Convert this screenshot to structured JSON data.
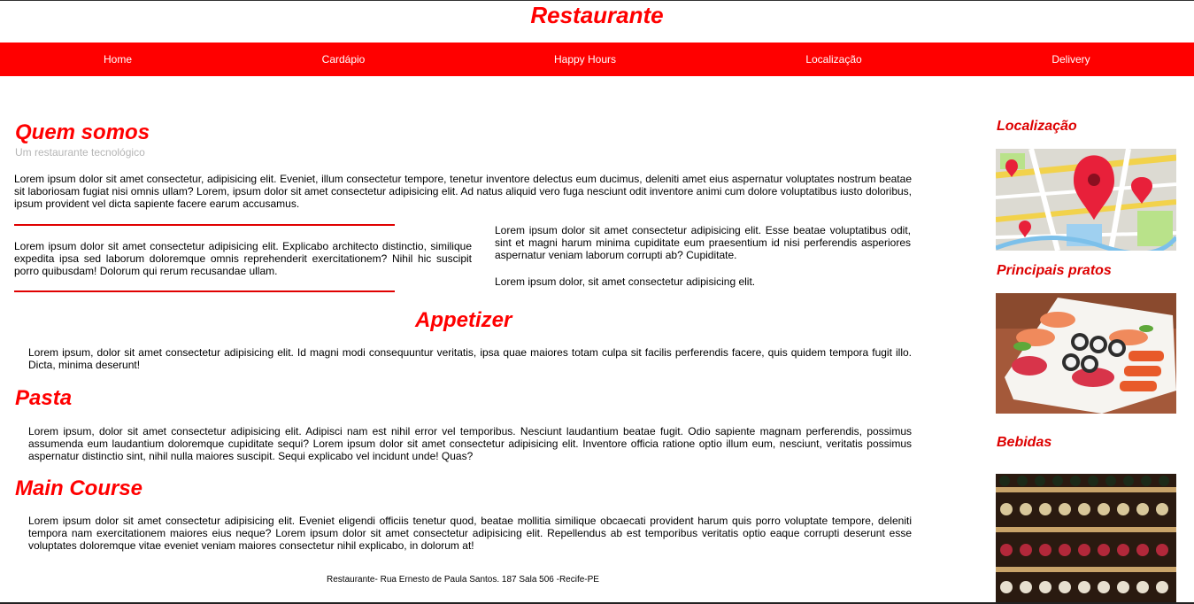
{
  "site": {
    "title": "Restaurante"
  },
  "nav": {
    "items": [
      {
        "label": "Home"
      },
      {
        "label": "Cardápio"
      },
      {
        "label": "Happy Hours"
      },
      {
        "label": "Localização"
      },
      {
        "label": "Delivery"
      }
    ]
  },
  "about": {
    "heading": "Quem somos",
    "subtitle": "Um restaurante tecnológico",
    "intro": "Lorem ipsum dolor sit amet consectetur, adipisicing elit. Eveniet, illum consectetur tempore, tenetur inventore delectus eum ducimus, deleniti amet eius aspernatur voluptates nostrum beatae sit laboriosam fugiat nisi omnis ullam? Lorem, ipsum dolor sit amet consectetur adipisicing elit. Ad natus aliquid vero fuga nesciunt odit inventore animi cum dolore voluptatibus iusto doloribus, ipsum provident vel dicta sapiente facere earum accusamus.",
    "left_col": "Lorem ipsum dolor sit amet consectetur adipisicing elit. Explicabo architecto distinctio, similique expedita ipsa sed laborum doloremque omnis reprehenderit exercitationem? Nihil hic suscipit porro quibusdam! Dolorum qui rerum recusandae ullam.",
    "right_col_1": "Lorem ipsum dolor sit amet consectetur adipisicing elit. Esse beatae voluptatibus odit, sint et magni harum minima cupiditate eum praesentium id nisi perferendis asperiores aspernatur veniam laborum corrupti ab? Cupiditate.",
    "right_col_2": "Lorem ipsum dolor, sit amet consectetur adipisicing elit."
  },
  "appetizer": {
    "heading": "Appetizer",
    "text": "Lorem ipsum, dolor sit amet consectetur adipisicing elit. Id magni modi consequuntur veritatis, ipsa quae maiores totam culpa sit facilis perferendis facere, quis quidem tempora fugit illo. Dicta, minima deserunt!"
  },
  "pasta": {
    "heading": "Pasta",
    "text": "Lorem ipsum, dolor sit amet consectetur adipisicing elit. Adipisci nam est nihil error vel temporibus. Nesciunt laudantium beatae fugit. Odio sapiente magnam perferendis, possimus assumenda eum laudantium doloremque cupiditate sequi? Lorem ipsum dolor sit amet consectetur adipisicing elit. Inventore officia ratione optio illum eum, nesciunt, veritatis possimus aspernatur distinctio sint, nihil nulla maiores suscipit. Sequi explicabo vel incidunt unde! Quas?"
  },
  "main_course": {
    "heading": "Main Course",
    "text": "Lorem ipsum dolor sit amet consectetur adipisicing elit. Eveniet eligendi officiis tenetur quod, beatae mollitia similique obcaecati provident harum quis porro voluptate tempore, deleniti tempora nam exercitationem maiores eius neque? Lorem ipsum dolor sit amet consectetur adipisicing elit. Repellendus ab est temporibus veritatis optio eaque corrupti deserunt esse voluptates doloremque vitae eveniet veniam maiores consectetur nihil explicabo, in dolorum at!"
  },
  "aside": {
    "location_heading": "Localização",
    "dishes_heading": "Principais pratos",
    "drinks_heading": "Bebidas"
  },
  "footer": {
    "text": "Restaurante- Rua Ernesto de Paula Santos. 187 Sala 506 -Recife-PE"
  },
  "colors": {
    "brand_red": "#ff0000",
    "subtitle_gray": "#b5b5b5"
  }
}
